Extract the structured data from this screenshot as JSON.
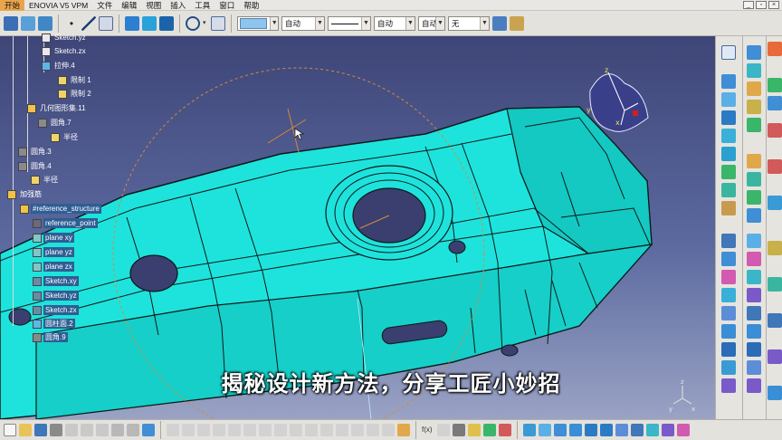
{
  "menubar": {
    "items": [
      "开始",
      "ENOVIA V5 VPM",
      "文件",
      "编辑",
      "视图",
      "插入",
      "工具",
      "窗口",
      "帮助"
    ]
  },
  "toolbar": {
    "color_value": "",
    "linetype_combo": "自动",
    "thickness_combo": "自动",
    "linestyle_combo": "自动",
    "layer_combo": "无"
  },
  "tree": {
    "items": [
      {
        "label": "Sketch.yz",
        "highlight": false
      },
      {
        "label": "Sketch.zx",
        "highlight": false
      },
      {
        "label": "拉伸.4",
        "highlight": false
      },
      {
        "label": "限制 1",
        "highlight": false
      },
      {
        "label": "限制 2",
        "highlight": false
      },
      {
        "label": "几何图形集.11",
        "highlight": false
      },
      {
        "label": "圆角.7",
        "highlight": false
      },
      {
        "label": "半径",
        "highlight": false
      },
      {
        "label": "圆角.3",
        "highlight": false
      },
      {
        "label": "圆角.4",
        "highlight": false
      },
      {
        "label": "半径",
        "highlight": false
      },
      {
        "label": "加强筋",
        "highlight": false
      },
      {
        "label": "#reference_structure",
        "highlight": true
      },
      {
        "label": "reference_point",
        "highlight": true
      },
      {
        "label": "plane xy",
        "highlight": true
      },
      {
        "label": "plane yz",
        "highlight": true
      },
      {
        "label": "plane zx",
        "highlight": true
      },
      {
        "label": "Sketch.xy",
        "highlight": true
      },
      {
        "label": "Sketch.yz",
        "highlight": true
      },
      {
        "label": "Sketch.zx",
        "highlight": true
      },
      {
        "label": "圆柱面.2",
        "highlight": true
      },
      {
        "label": "圆角.9",
        "highlight": true
      }
    ]
  },
  "compass": {
    "x_label": "x",
    "y_label": "y",
    "z_label": "z"
  },
  "axis_triad": {
    "x_label": "x",
    "y_label": "y",
    "z_label": "z"
  },
  "caption": "揭秘设计新方法，分享工匠小妙招",
  "colors": {
    "part_fill": "#1ee3dc",
    "part_edge": "#0a1a1a",
    "viewport_top": "#3e4577",
    "sketch_circle": "#d48a3a",
    "highlight": "#2e5e93",
    "menu_active": "#e9a54b"
  },
  "icons": {
    "toolbar": [
      "cursor-icon",
      "sketch-icon",
      "point-icon",
      "line-icon",
      "polyline-icon",
      "circle-icon",
      "color-swatch",
      "paint-icon"
    ],
    "right_toolbar": [
      "sketcher-icon",
      "pad-icon",
      "pocket-icon",
      "shaft-icon",
      "fillet-icon",
      "chamfer-icon",
      "draft-icon",
      "shell-icon",
      "rib-icon",
      "measure-icon"
    ]
  }
}
